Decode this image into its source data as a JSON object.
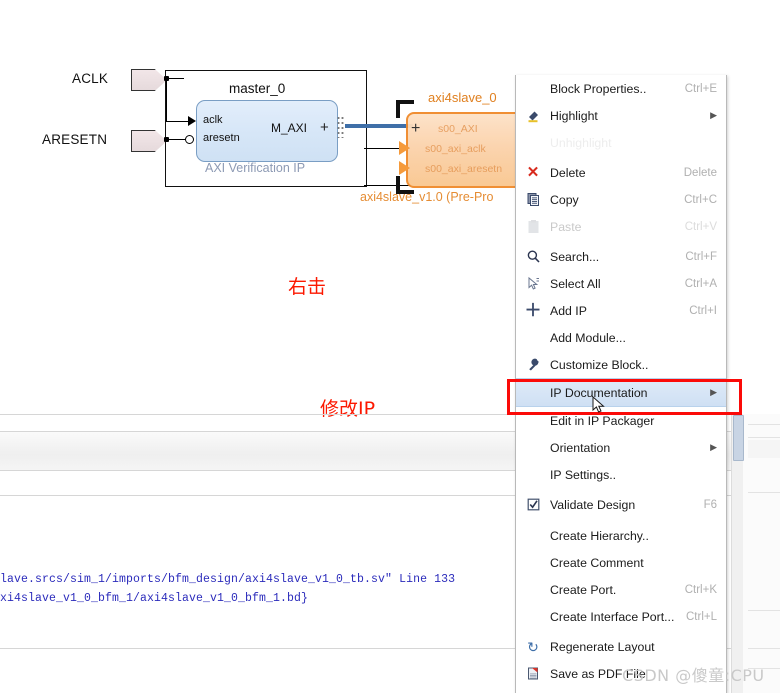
{
  "diagram": {
    "ports": [
      {
        "name": "ACLK"
      },
      {
        "name": "ARESETN"
      }
    ],
    "master_block": {
      "instance_name": "master_0",
      "vlnv_label": "AXI Verification IP",
      "input_pins": [
        "aclk",
        "aresetn"
      ],
      "interface_pin": "M_AXI",
      "expand_glyph": "+"
    },
    "slave_block": {
      "instance_name": "axi4slave_0",
      "vlnv_label": "axi4slave_v1.0 (Pre-Pro",
      "expand_glyph": "+",
      "inner_lines": [
        "s00_AXI",
        "s00_axi_aclk",
        "s00_axi_aresetn"
      ]
    }
  },
  "annotations": [
    {
      "text": "右击"
    },
    {
      "text": "修改IP"
    }
  ],
  "log": {
    "lines": [
      "lave.srcs/sim_1/imports/bfm_design/axi4slave_v1_0_tb.sv\" Line 133",
      "xi4slave_v1_0_bfm_1/axi4slave_v1_0_bfm_1.bd}"
    ]
  },
  "context_menu": {
    "items": [
      {
        "id": "block-properties",
        "label": "Block Properties..",
        "accel": "Ctrl+E",
        "icon": "none",
        "state": "normal",
        "submenu": false
      },
      {
        "id": "highlight",
        "label": "Highlight",
        "accel": "",
        "icon": "highlight",
        "state": "normal",
        "submenu": true
      },
      {
        "id": "unhighlight",
        "label": "Unhighlight",
        "accel": "",
        "icon": "none",
        "state": "ghost",
        "submenu": false
      },
      {
        "id": "delete",
        "label": "Delete",
        "accel": "Delete",
        "icon": "x",
        "state": "normal",
        "submenu": false
      },
      {
        "id": "copy",
        "label": "Copy",
        "accel": "Ctrl+C",
        "icon": "copy",
        "state": "normal",
        "submenu": false
      },
      {
        "id": "paste",
        "label": "Paste",
        "accel": "Ctrl+V",
        "icon": "paste",
        "state": "disabled",
        "submenu": false
      },
      {
        "id": "search",
        "label": "Search...",
        "accel": "Ctrl+F",
        "icon": "search",
        "state": "normal",
        "submenu": false
      },
      {
        "id": "select-all",
        "label": "Select All",
        "accel": "Ctrl+A",
        "icon": "selectall",
        "state": "normal",
        "submenu": false
      },
      {
        "id": "add-ip",
        "label": "Add IP",
        "accel": "Ctrl+I",
        "icon": "plus",
        "state": "normal",
        "submenu": false
      },
      {
        "id": "add-module",
        "label": "Add Module...",
        "accel": "",
        "icon": "none",
        "state": "normal",
        "submenu": false
      },
      {
        "id": "customize-block",
        "label": "Customize Block..",
        "accel": "",
        "icon": "wrench",
        "state": "normal",
        "submenu": false
      },
      {
        "id": "ip-documentation",
        "label": "IP Documentation",
        "accel": "",
        "icon": "none",
        "state": "selected",
        "submenu": true
      },
      {
        "id": "edit-ip-packager",
        "label": "Edit in IP Packager",
        "accel": "",
        "icon": "none",
        "state": "normal",
        "submenu": false
      },
      {
        "id": "orientation",
        "label": "Orientation",
        "accel": "",
        "icon": "none",
        "state": "normal",
        "submenu": true
      },
      {
        "id": "ip-settings",
        "label": "IP Settings..",
        "accel": "",
        "icon": "none",
        "state": "normal",
        "submenu": false
      },
      {
        "id": "validate-design",
        "label": "Validate Design",
        "accel": "F6",
        "icon": "check",
        "state": "normal",
        "submenu": false
      },
      {
        "id": "create-hierarchy",
        "label": "Create Hierarchy..",
        "accel": "",
        "icon": "none",
        "state": "normal",
        "submenu": false
      },
      {
        "id": "create-comment",
        "label": "Create Comment",
        "accel": "",
        "icon": "none",
        "state": "normal",
        "submenu": false
      },
      {
        "id": "create-port",
        "label": "Create Port.",
        "accel": "Ctrl+K",
        "icon": "none",
        "state": "normal",
        "submenu": false
      },
      {
        "id": "create-iface-port",
        "label": "Create Interface Port...",
        "accel": "Ctrl+L",
        "icon": "none",
        "state": "normal",
        "submenu": false
      },
      {
        "id": "regenerate-layout",
        "label": "Regenerate Layout",
        "accel": "",
        "icon": "refresh",
        "state": "normal",
        "submenu": false
      },
      {
        "id": "save-as-pdf",
        "label": "Save as PDF File",
        "accel": "",
        "icon": "pdf",
        "state": "normal",
        "submenu": false
      }
    ]
  },
  "watermark": {
    "text": "CSDN @傻童:CPU"
  },
  "colors": {
    "highlight_blue": "#cfe0f4",
    "red_box": "#fb0a08",
    "annotation_red": "#fc1800",
    "slave_orange": "#f08a2a",
    "bus_blue": "#3f6fa8"
  }
}
